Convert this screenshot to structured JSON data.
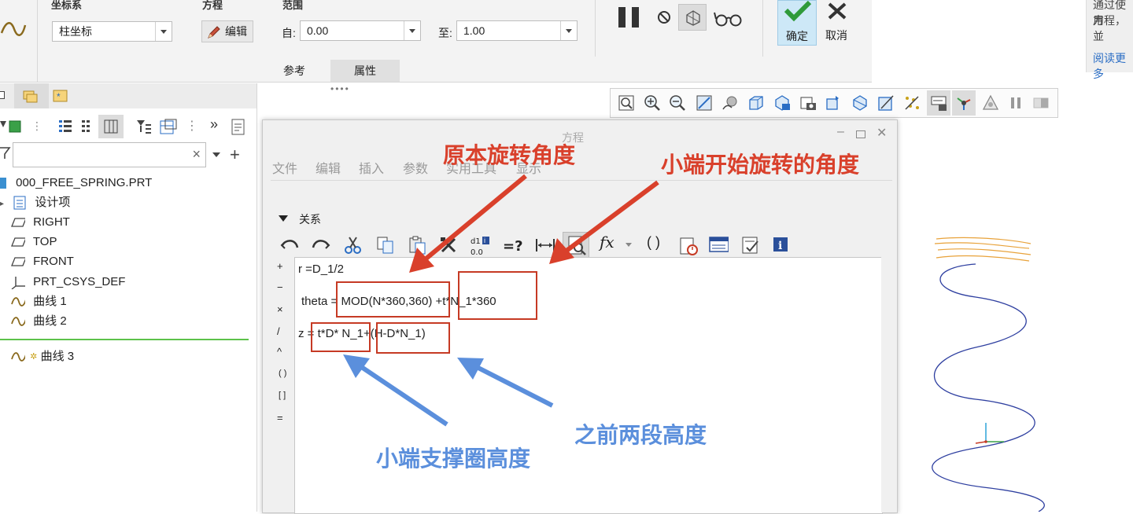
{
  "ribbon": {
    "coord_group_title": "坐标系",
    "coord_value": "柱坐标",
    "equation_group_title": "方程",
    "edit_label": "编辑",
    "range_group_title": "范围",
    "from_label": "自:",
    "from_value": "0.00",
    "to_label": "至:",
    "to_value": "1.00",
    "ok_label": "确定",
    "cancel_label": "取消",
    "tabs": [
      {
        "label": "参考"
      },
      {
        "label": "属性"
      }
    ]
  },
  "side_info": {
    "line1": "通过使用",
    "line2": "方程，並",
    "link": "阅读更多"
  },
  "tree": {
    "items": [
      {
        "label": "000_FREE_SPRING.PRT"
      },
      {
        "label": "设计项"
      },
      {
        "label": "RIGHT"
      },
      {
        "label": "TOP"
      },
      {
        "label": "FRONT"
      },
      {
        "label": "PRT_CSYS_DEF"
      },
      {
        "label": "曲线 1"
      },
      {
        "label": "曲线 2"
      },
      {
        "label": "曲线 3"
      }
    ],
    "close_symbol": "×",
    "more_symbol": "»",
    "add_symbol": "+"
  },
  "dialog": {
    "title": "方程",
    "menus": [
      {
        "label": "文件"
      },
      {
        "label": "编辑"
      },
      {
        "label": "插入"
      },
      {
        "label": "参数"
      },
      {
        "label": "实用工具"
      },
      {
        "label": "显示"
      }
    ],
    "section_label": "关系",
    "operators": [
      "+",
      "−",
      "×",
      "/",
      "^",
      "( )",
      "[ ]",
      "="
    ],
    "fx_label": "fx",
    "brackets_label": "( )",
    "code_lines": {
      "line1": "r =D_1/2",
      "line2": "theta = MOD(N*360,360) +t*N_1*360",
      "line3": "z = t*D* N_1+(H-D*N_1)"
    }
  },
  "annotations": {
    "red1": "原本旋转角度",
    "red2": "小端开始旋转的角度",
    "blue1": "小端支撑圈高度",
    "blue2": "之前两段高度"
  },
  "colors": {
    "annotation_red": "#d9402b",
    "annotation_blue": "#5b8fdc",
    "ok_bg": "#cde8f7",
    "curve_blue": "#2e3fa0",
    "curve_orange": "#e8a23a"
  }
}
